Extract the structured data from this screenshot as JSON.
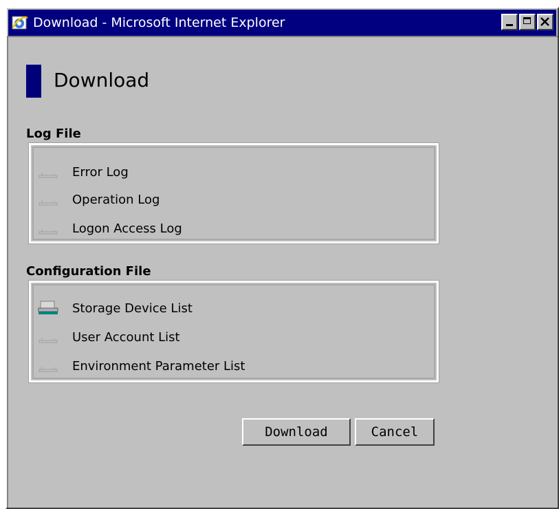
{
  "window": {
    "title": "Download - Microsoft Internet Explorer",
    "app_icon": "ie-icon",
    "caption_buttons": [
      "minimize-icon",
      "maximize-icon",
      "close-icon"
    ]
  },
  "page": {
    "heading": "Download",
    "heading_accent_color": "#00007a"
  },
  "log_file": {
    "label": "Log File",
    "items": [
      {
        "label": "Error Log",
        "icon": "download-icon",
        "enabled": false
      },
      {
        "label": "Operation Log",
        "icon": "download-icon",
        "enabled": false
      },
      {
        "label": "Logon Access Log",
        "icon": "download-icon",
        "enabled": false
      }
    ]
  },
  "config_file": {
    "label": "Configuration File",
    "items": [
      {
        "label": "Storage Device List",
        "icon": "download-icon",
        "enabled": true
      },
      {
        "label": "User Account List",
        "icon": "download-icon",
        "enabled": false
      },
      {
        "label": "Environment Parameter List",
        "icon": "download-icon",
        "enabled": false
      }
    ]
  },
  "buttons": {
    "download": "Download",
    "cancel": "Cancel"
  }
}
